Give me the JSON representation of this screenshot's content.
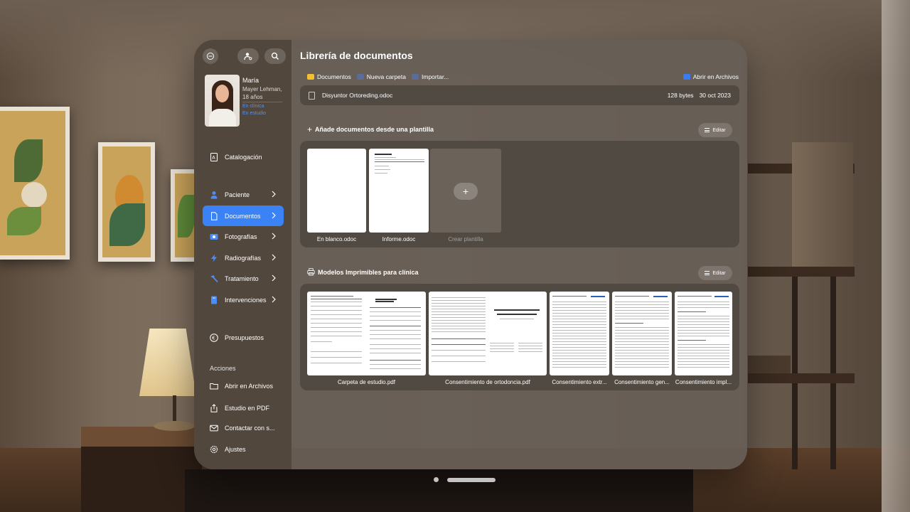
{
  "app": {
    "window_title": "Librería de documentos"
  },
  "sidebar": {
    "patient": {
      "name": "María",
      "surname": "Mayer Lehman,",
      "age": "18 años",
      "status_line1": "En clínica",
      "status_line2": "En estudio"
    },
    "catalog_label": "Catalogación",
    "nav": [
      {
        "label": "Paciente",
        "icon": "person-icon"
      },
      {
        "label": "Documentos",
        "icon": "document-icon",
        "active": true
      },
      {
        "label": "Fotografías",
        "icon": "photos-icon"
      },
      {
        "label": "Radiografías",
        "icon": "bolt-icon"
      },
      {
        "label": "Tratamiento",
        "icon": "hammer-icon"
      },
      {
        "label": "Intervenciones",
        "icon": "book-icon"
      }
    ],
    "budget_label": "Presupuestos",
    "actions_title": "Acciones",
    "actions": [
      {
        "label": "Abrir en Archivos",
        "icon": "folder-icon"
      },
      {
        "label": "Estudio en PDF",
        "icon": "share-icon"
      },
      {
        "label": "Contactar con s...",
        "icon": "envelope-icon"
      },
      {
        "label": "Ajustes",
        "icon": "gear-icon"
      }
    ]
  },
  "toolbar": {
    "documents": "Documentos",
    "new_folder": "Nueva carpeta",
    "import": "Importar...",
    "open_in_files": "Abrir en Archivos"
  },
  "file": {
    "name": "Disyuntor Ortoreding.odoc",
    "size": "128 bytes",
    "date": "30 oct 2023"
  },
  "templates": {
    "title": "Añade documentos desde una plantilla",
    "edit_label": "Editar",
    "items": [
      {
        "label": "En blanco.odoc"
      },
      {
        "label": "Informe.odoc"
      }
    ],
    "create_label": "Crear plantilla",
    "add_symbol": "+",
    "plus_symbol": "+"
  },
  "printables": {
    "title": "Modelos Imprimibles para clínica",
    "edit_label": "Editar",
    "items": [
      {
        "label": "Carpeta de estudio.pdf"
      },
      {
        "label": "Consentimiento de ortodoncia.pdf"
      },
      {
        "label": "Consentimiento extr..."
      },
      {
        "label": "Consentimiento gen..."
      },
      {
        "label": "Consentimiento impl..."
      }
    ]
  },
  "colors": {
    "accent": "#3a82f6",
    "folder": "#f5c02e",
    "link": "#5b8fe0"
  }
}
